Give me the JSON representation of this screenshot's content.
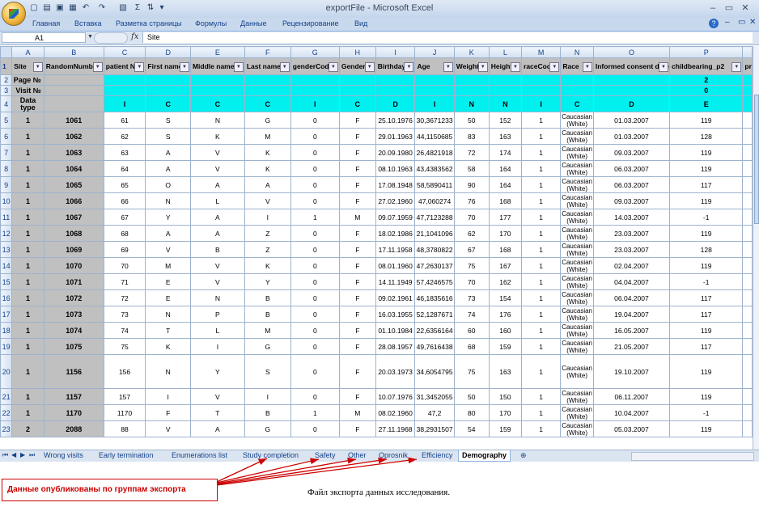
{
  "app": {
    "window_title": "exportFile - Microsoft Excel",
    "ribbon_tabs": [
      "Главная",
      "Вставка",
      "Разметка страницы",
      "Формулы",
      "Данные",
      "Рецензирование",
      "Вид"
    ]
  },
  "formula_bar": {
    "name_box": "A1",
    "fx_label": "fx",
    "content": "Site"
  },
  "sheet": {
    "columns": [
      "A",
      "B",
      "C",
      "D",
      "E",
      "F",
      "G",
      "H",
      "I",
      "J",
      "K",
      "L",
      "M",
      "N",
      "O",
      "P"
    ],
    "header_row": [
      "Site",
      "RandomNumbe",
      "patient №",
      "First name",
      "Middle name",
      "Last name",
      "genderCode",
      "Gender",
      "Birthday",
      "Age",
      "Weight",
      "Height",
      "raceCode",
      "Race",
      "Informed consent date",
      "childbearing_p2",
      "pr"
    ],
    "meta_rows": [
      {
        "row": "2",
        "label": "Page №",
        "p": "2"
      },
      {
        "row": "3",
        "label": "Visit №",
        "p": "0"
      },
      {
        "row": "4",
        "label": "Data type",
        "types": [
          "I",
          "C",
          "C",
          "C",
          "I",
          "C",
          "D",
          "I",
          "N",
          "N",
          "I",
          "C",
          "D",
          "E"
        ]
      }
    ],
    "data_rows": [
      {
        "row": "5",
        "cells": [
          "1",
          "1061",
          "61",
          "S",
          "N",
          "G",
          "0",
          "F",
          "25.10.1976",
          "30,3671233",
          "50",
          "152",
          "1",
          "Caucasian (White)",
          "01.03.2007",
          "119"
        ]
      },
      {
        "row": "6",
        "cells": [
          "1",
          "1062",
          "62",
          "S",
          "K",
          "M",
          "0",
          "F",
          "29.01.1963",
          "44,1150685",
          "83",
          "163",
          "1",
          "Caucasian (White)",
          "01.03.2007",
          "128"
        ]
      },
      {
        "row": "7",
        "cells": [
          "1",
          "1063",
          "63",
          "A",
          "V",
          "K",
          "0",
          "F",
          "20.09.1980",
          "26,4821918",
          "72",
          "174",
          "1",
          "Caucasian (White)",
          "09.03.2007",
          "119"
        ]
      },
      {
        "row": "8",
        "cells": [
          "1",
          "1064",
          "64",
          "A",
          "V",
          "K",
          "0",
          "F",
          "08.10.1963",
          "43,4383562",
          "58",
          "164",
          "1",
          "Caucasian (White)",
          "06.03.2007",
          "119"
        ]
      },
      {
        "row": "9",
        "cells": [
          "1",
          "1065",
          "65",
          "O",
          "A",
          "A",
          "0",
          "F",
          "17.08.1948",
          "58,5890411",
          "90",
          "164",
          "1",
          "Caucasian (White)",
          "06.03.2007",
          "117"
        ]
      },
      {
        "row": "10",
        "cells": [
          "1",
          "1066",
          "66",
          "N",
          "L",
          "V",
          "0",
          "F",
          "27.02.1960",
          "47,060274",
          "76",
          "168",
          "1",
          "Caucasian (White)",
          "09.03.2007",
          "119"
        ]
      },
      {
        "row": "11",
        "cells": [
          "1",
          "1067",
          "67",
          "Y",
          "A",
          "I",
          "1",
          "M",
          "09.07.1959",
          "47,7123288",
          "70",
          "177",
          "1",
          "Caucasian (White)",
          "14.03.2007",
          "-1"
        ]
      },
      {
        "row": "12",
        "cells": [
          "1",
          "1068",
          "68",
          "A",
          "A",
          "Z",
          "0",
          "F",
          "18.02.1986",
          "21,1041096",
          "62",
          "170",
          "1",
          "Caucasian (White)",
          "23.03.2007",
          "119"
        ]
      },
      {
        "row": "13",
        "cells": [
          "1",
          "1069",
          "69",
          "V",
          "B",
          "Z",
          "0",
          "F",
          "17.11.1958",
          "48,3780822",
          "67",
          "168",
          "1",
          "Caucasian (White)",
          "23.03.2007",
          "128"
        ]
      },
      {
        "row": "14",
        "cells": [
          "1",
          "1070",
          "70",
          "M",
          "V",
          "K",
          "0",
          "F",
          "08.01.1960",
          "47,2630137",
          "75",
          "167",
          "1",
          "Caucasian (White)",
          "02.04.2007",
          "119"
        ]
      },
      {
        "row": "15",
        "cells": [
          "1",
          "1071",
          "71",
          "E",
          "V",
          "Y",
          "0",
          "F",
          "14.11.1949",
          "57,4246575",
          "70",
          "162",
          "1",
          "Caucasian (White)",
          "04.04.2007",
          "-1"
        ]
      },
      {
        "row": "16",
        "cells": [
          "1",
          "1072",
          "72",
          "E",
          "N",
          "B",
          "0",
          "F",
          "09.02.1961",
          "46,1835616",
          "73",
          "154",
          "1",
          "Caucasian (White)",
          "06.04.2007",
          "117"
        ]
      },
      {
        "row": "17",
        "cells": [
          "1",
          "1073",
          "73",
          "N",
          "P",
          "B",
          "0",
          "F",
          "16.03.1955",
          "52,1287671",
          "74",
          "176",
          "1",
          "Caucasian (White)",
          "19.04.2007",
          "117"
        ]
      },
      {
        "row": "18",
        "cells": [
          "1",
          "1074",
          "74",
          "T",
          "L",
          "M",
          "0",
          "F",
          "01.10.1984",
          "22,6356164",
          "60",
          "160",
          "1",
          "Caucasian (White)",
          "16.05.2007",
          "119"
        ]
      },
      {
        "row": "19",
        "cells": [
          "1",
          "1075",
          "75",
          "K",
          "I",
          "G",
          "0",
          "F",
          "28.08.1957",
          "49,7616438",
          "68",
          "159",
          "1",
          "Caucasian (White)",
          "21.05.2007",
          "117"
        ]
      },
      {
        "row": "20",
        "cells": [
          "1",
          "1156",
          "156",
          "N",
          "Y",
          "S",
          "0",
          "F",
          "20.03.1973",
          "34,6054795",
          "75",
          "163",
          "1",
          "Caucasian (White)",
          "19.10.2007",
          "119"
        ]
      },
      {
        "row": "21",
        "cells": [
          "1",
          "1157",
          "157",
          "I",
          "V",
          "I",
          "0",
          "F",
          "10.07.1976",
          "31,3452055",
          "50",
          "150",
          "1",
          "Caucasian (White)",
          "06.11.2007",
          "119"
        ]
      },
      {
        "row": "22",
        "cells": [
          "1",
          "1170",
          "1170",
          "F",
          "T",
          "B",
          "1",
          "M",
          "08.02.1960",
          "47,2",
          "80",
          "170",
          "1",
          "Caucasian (White)",
          "10.04.2007",
          "-1"
        ]
      },
      {
        "row": "23",
        "cells": [
          "2",
          "2088",
          "88",
          "V",
          "A",
          "G",
          "0",
          "F",
          "27.11.1968",
          "38,2931507",
          "54",
          "159",
          "1",
          "Caucasian (White)",
          "05.03.2007",
          "119"
        ]
      }
    ]
  },
  "sheet_tabs": [
    "Wrong visits",
    "Early termination",
    "Enumerations list",
    "Study completion",
    "Safety",
    "Other",
    "Oprosnik",
    "Efficiency",
    "Demography"
  ],
  "active_sheet": "Demography",
  "annotation": "Данные опубликованы по группам экспорта",
  "caption": "Файл экспорта данных исследования."
}
